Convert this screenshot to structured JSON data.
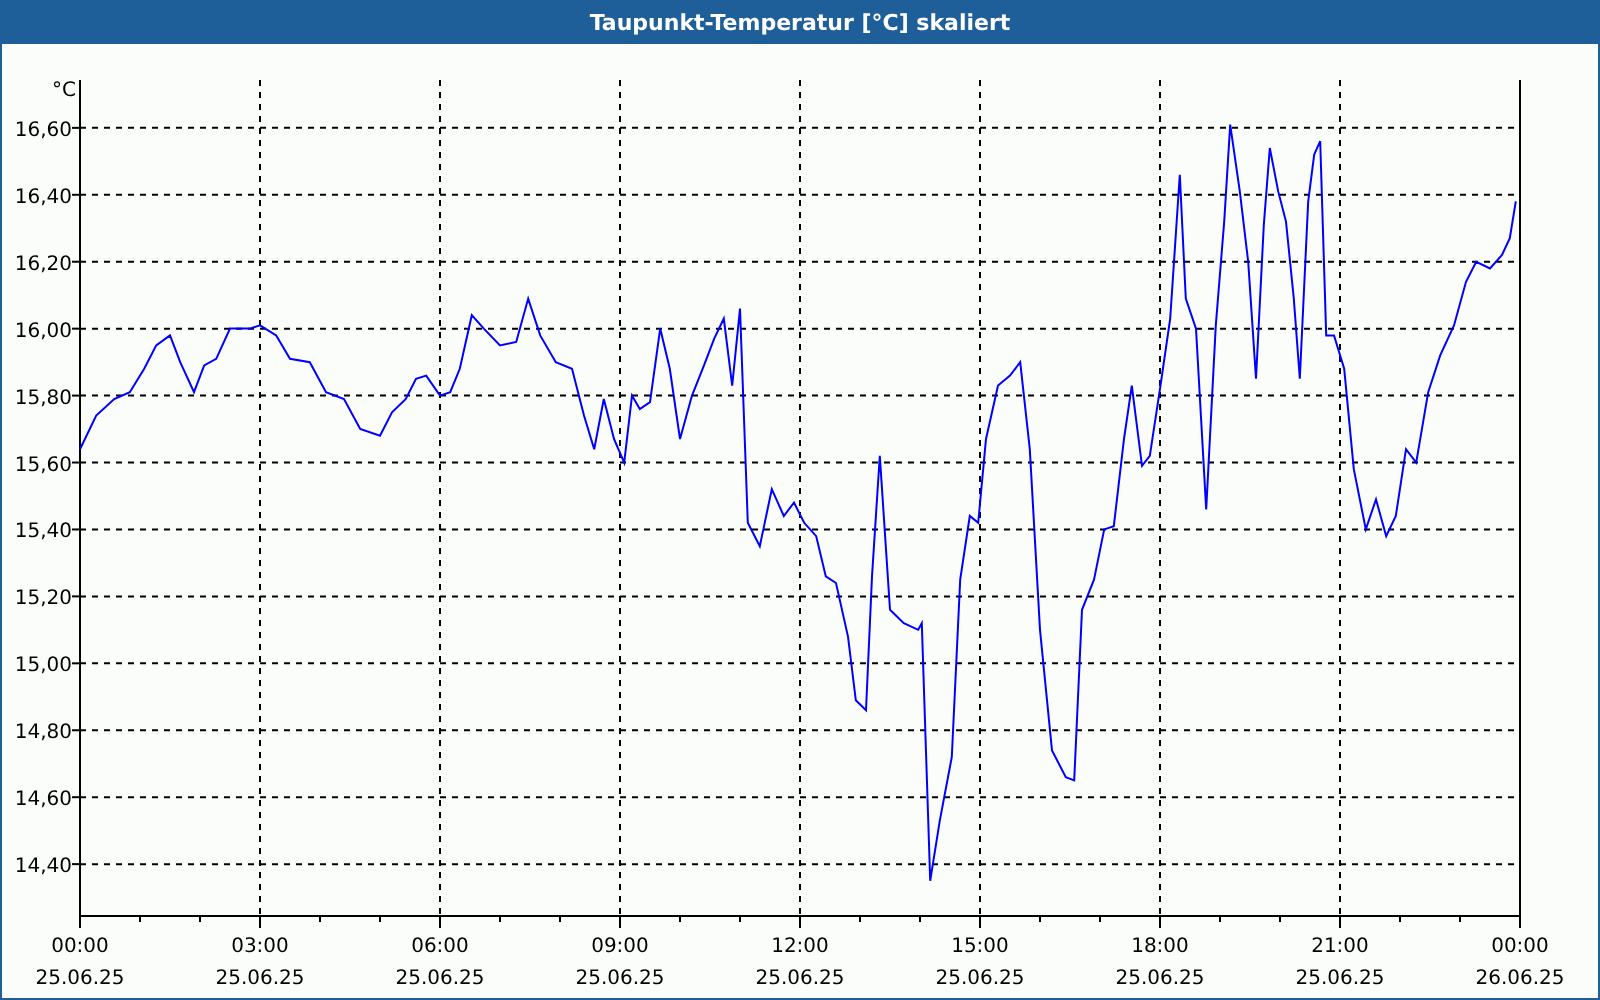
{
  "window": {
    "title": "Taupunkt-Temperatur [°C] skaliert"
  },
  "chart": {
    "chart_data": {
      "type": "line",
      "grid": true,
      "ylabel": "°C",
      "xlim": [
        0,
        24
      ],
      "ylim": [
        14.245,
        16.743
      ],
      "xticks": [
        {
          "value": 0,
          "label": "00:00"
        },
        {
          "value": 3,
          "label": "03:00"
        },
        {
          "value": 6,
          "label": "06:00"
        },
        {
          "value": 9,
          "label": "09:00"
        },
        {
          "value": 12,
          "label": "12:00"
        },
        {
          "value": 15,
          "label": "15:00"
        },
        {
          "value": 18,
          "label": "18:00"
        },
        {
          "value": 21,
          "label": "21:00"
        },
        {
          "value": 24,
          "label": "00:00"
        }
      ],
      "annotations": [
        "25.06.25",
        "25.06.25",
        "25.06.25",
        "25.06.25",
        "25.06.25",
        "25.06.25",
        "25.06.25",
        "25.06.25",
        "26.06.25"
      ],
      "yticks": [
        {
          "value": 14.4,
          "label": "14,40"
        },
        {
          "value": 14.6,
          "label": "14,60"
        },
        {
          "value": 14.8,
          "label": "14,80"
        },
        {
          "value": 15.0,
          "label": "15,00"
        },
        {
          "value": 15.2,
          "label": "15,20"
        },
        {
          "value": 15.4,
          "label": "15,40"
        },
        {
          "value": 15.6,
          "label": "15,60"
        },
        {
          "value": 15.8,
          "label": "15,80"
        },
        {
          "value": 16.0,
          "label": "16,00"
        },
        {
          "value": 16.2,
          "label": "16,20"
        },
        {
          "value": 16.4,
          "label": "16,40"
        },
        {
          "value": 16.6,
          "label": "16,60"
        }
      ],
      "x": [
        0,
        0.27,
        0.57,
        0.83,
        1.07,
        1.27,
        1.5,
        1.67,
        1.9,
        2.07,
        2.27,
        2.5,
        2.83,
        3,
        3.27,
        3.5,
        3.83,
        4.1,
        4.4,
        4.67,
        5,
        5.2,
        5.43,
        5.6,
        5.77,
        6,
        6.17,
        6.33,
        6.53,
        6.73,
        7,
        7.27,
        7.47,
        7.67,
        7.93,
        8.2,
        8.4,
        8.57,
        8.73,
        8.9,
        9.07,
        9.2,
        9.33,
        9.5,
        9.67,
        9.83,
        10,
        10.2,
        10.4,
        10.57,
        10.73,
        10.87,
        11,
        11.13,
        11.33,
        11.53,
        11.73,
        11.9,
        12.07,
        12.27,
        12.43,
        12.6,
        12.8,
        12.93,
        13.1,
        13.2,
        13.33,
        13.5,
        13.73,
        13.97,
        14.03,
        14.17,
        14.33,
        14.53,
        14.67,
        14.83,
        14.97,
        15.1,
        15.3,
        15.5,
        15.67,
        15.83,
        16,
        16.2,
        16.43,
        16.57,
        16.7,
        16.9,
        17.07,
        17.23,
        17.4,
        17.53,
        17.7,
        17.83,
        18,
        18.17,
        18.33,
        18.43,
        18.6,
        18.77,
        18.93,
        19.07,
        19.17,
        19.33,
        19.47,
        19.6,
        19.73,
        19.83,
        19.97,
        20.1,
        20.23,
        20.33,
        20.47,
        20.57,
        20.67,
        20.77,
        20.9,
        21.07,
        21.23,
        21.43,
        21.6,
        21.77,
        21.93,
        22.1,
        22.27,
        22.47,
        22.67,
        22.9,
        23.1,
        23.27,
        23.5,
        23.7,
        23.83,
        23.93
      ],
      "series": [
        {
          "color": "#0000ff",
          "values": [
            15.64,
            15.74,
            15.79,
            15.81,
            15.88,
            15.95,
            15.98,
            15.9,
            15.81,
            15.89,
            15.91,
            16.0,
            16.0,
            16.01,
            15.98,
            15.91,
            15.9,
            15.81,
            15.79,
            15.7,
            15.68,
            15.75,
            15.79,
            15.85,
            15.86,
            15.8,
            15.81,
            15.88,
            16.04,
            16.0,
            15.95,
            15.96,
            16.09,
            15.98,
            15.9,
            15.88,
            15.74,
            15.64,
            15.79,
            15.67,
            15.6,
            15.8,
            15.76,
            15.78,
            16.0,
            15.88,
            15.67,
            15.8,
            15.89,
            15.97,
            16.03,
            15.83,
            16.06,
            15.42,
            15.35,
            15.52,
            15.44,
            15.48,
            15.42,
            15.38,
            15.26,
            15.24,
            15.08,
            14.89,
            14.86,
            15.26,
            15.62,
            15.16,
            15.12,
            15.1,
            15.12,
            14.35,
            14.53,
            14.72,
            15.25,
            15.44,
            15.42,
            15.67,
            15.83,
            15.86,
            15.9,
            15.64,
            15.1,
            14.74,
            14.66,
            14.65,
            15.16,
            15.25,
            15.4,
            15.41,
            15.67,
            15.83,
            15.59,
            15.62,
            15.82,
            16.03,
            16.46,
            16.09,
            16.0,
            15.46,
            16.01,
            16.32,
            16.61,
            16.41,
            16.2,
            15.85,
            16.31,
            16.54,
            16.41,
            16.32,
            16.09,
            15.85,
            16.38,
            16.52,
            16.56,
            15.98,
            15.98,
            15.88,
            15.58,
            15.4,
            15.49,
            15.38,
            15.44,
            15.64,
            15.6,
            15.81,
            15.92,
            16.01,
            16.14,
            16.2,
            16.18,
            16.22,
            16.27,
            16.38
          ]
        }
      ]
    }
  }
}
